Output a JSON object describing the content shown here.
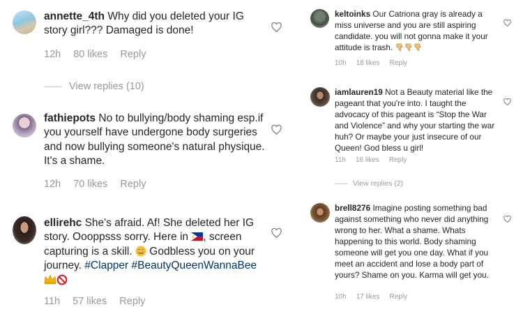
{
  "colors": {
    "link": "#003569",
    "meta": "#999999",
    "text": "#262626",
    "flag_blue": "#0038a8",
    "flag_red": "#ce1126"
  },
  "left": {
    "comments": [
      {
        "username": "annette_4th",
        "text": "Why did you deleted your IG story girl??? Damaged is done!",
        "time": "12h",
        "likes": "80 likes",
        "reply": "Reply",
        "view_replies": "View replies (10)"
      },
      {
        "username": "fathiepots",
        "text": "No to bullying/body shaming esp.if you yourself have undergone body surgeries and now bullying someone's natural physique. It's a shame.",
        "time": "12h",
        "likes": "70 likes",
        "reply": "Reply"
      },
      {
        "username": "ellirehc",
        "text_a": "She's afraid. Af! She deleted her IG story. Oooppsss sorry.  Here in",
        "text_b": ", screen capturing is a skill.",
        "text_c": "Godbless you on your journey.",
        "hashtag1": "#Clapper",
        "hashtag2": "#BeautyQueenWannaBee",
        "time": "11h",
        "likes": "57 likes",
        "reply": "Reply"
      }
    ]
  },
  "right": {
    "comments": [
      {
        "username": "keltoinks",
        "text": "Our Catriona gray is already a miss universe and you are still aspiring candidate. you will not gonna make it your attitude is trash.",
        "time": "10h",
        "likes": "18 likes",
        "reply": "Reply"
      },
      {
        "username": "iamlauren19",
        "text": "Not a Beauty material like the pageant that you're into. I taught the advocacy of this pageant is “Stop the War and Violence” and why your starting the war huh? Or maybe your just insecure of our Queen! God bless u girl!",
        "time": "11h",
        "likes": "16 likes",
        "reply": "Reply",
        "view_replies": "View replies (2)"
      },
      {
        "username": "brell8276",
        "text": "Imagine posting something bad against something who never did anything wrong to her. What a shame. Whats happening to this world. Body shaming someone will get you one day. What if you meet an accident and lose a body part of yours? Shame on you. Karma will get you.",
        "time": "10h",
        "likes": "17 likes",
        "reply": "Reply"
      }
    ]
  }
}
